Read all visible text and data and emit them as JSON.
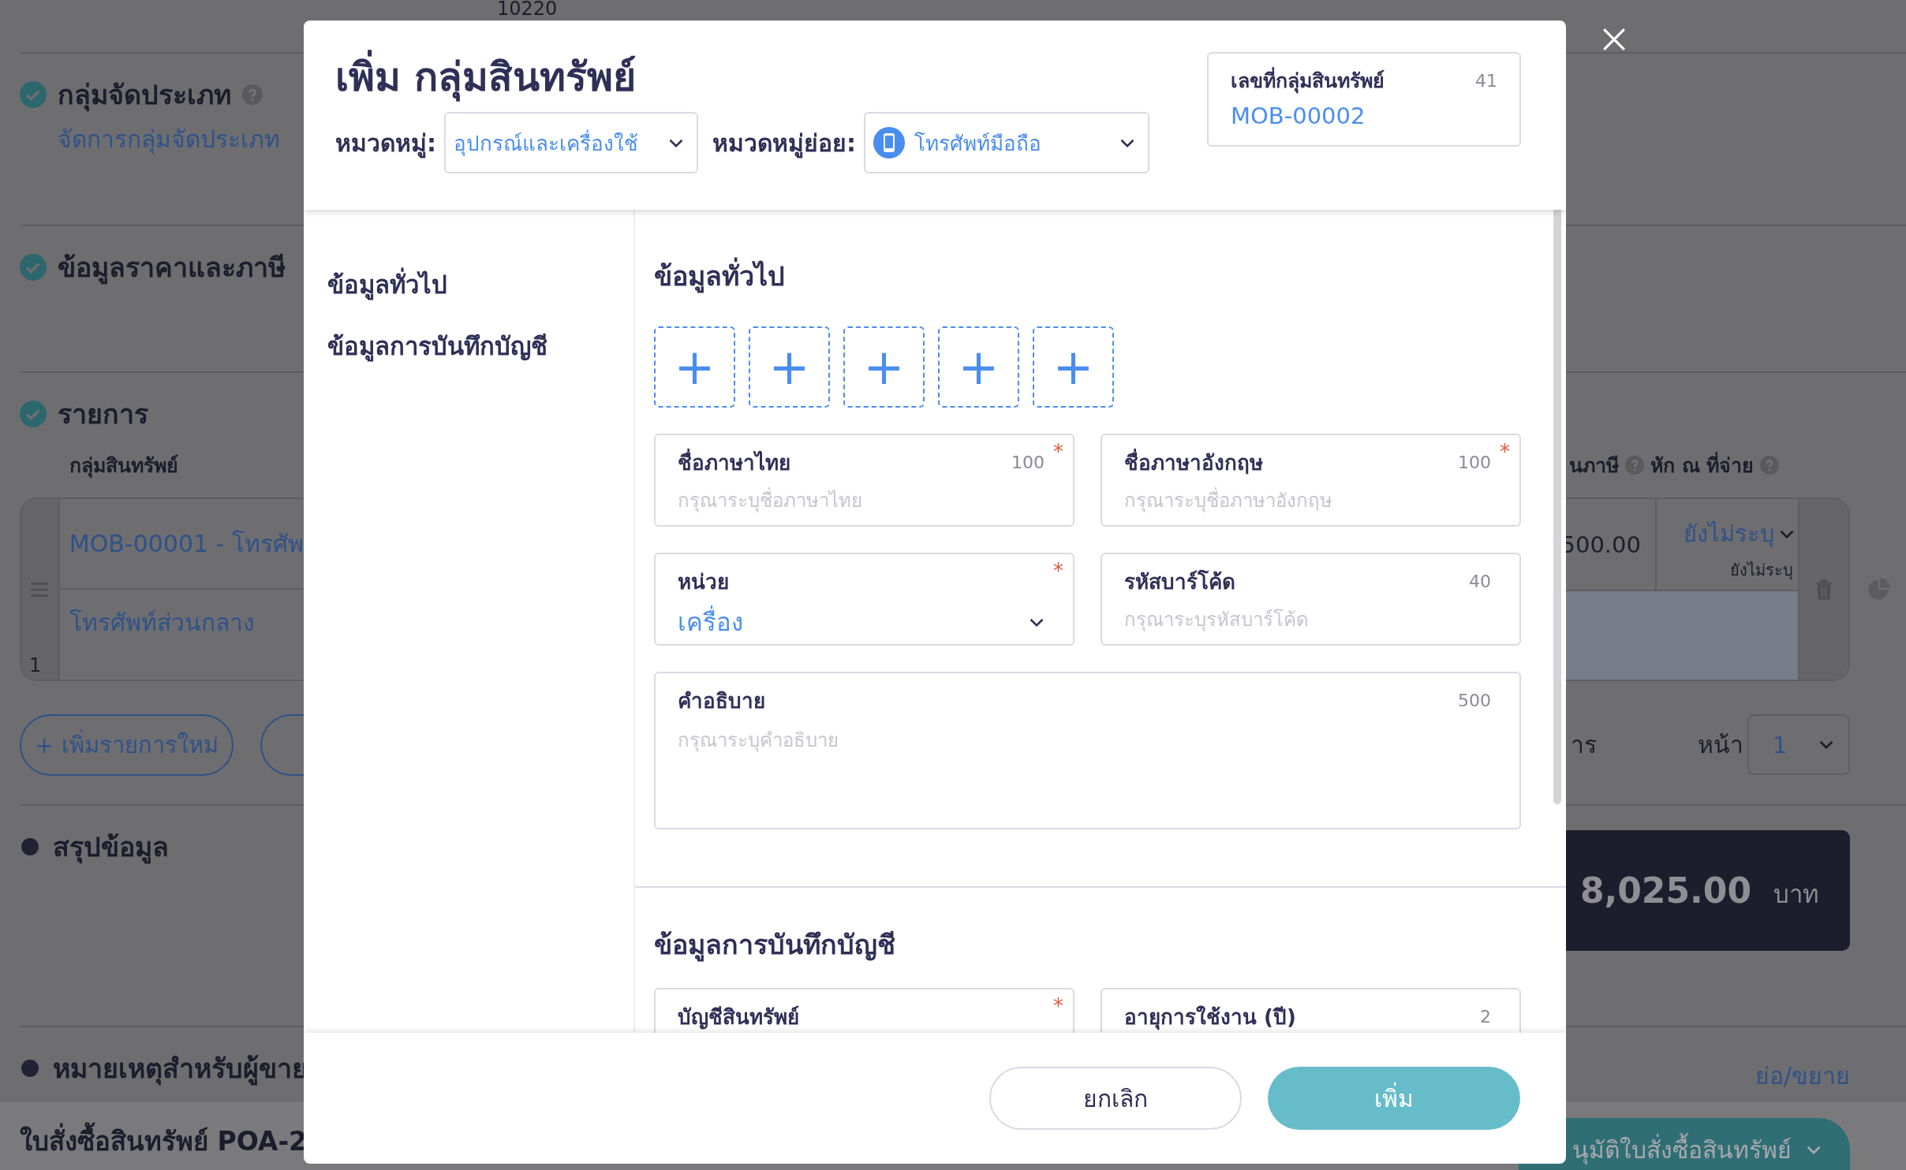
{
  "page": {
    "postal_code": "10220",
    "classification": {
      "title": "กลุ่มจัดประเภท",
      "done": true,
      "help": true,
      "link": "จัดการกลุ่มจัดประเภท"
    },
    "pricing": {
      "title": "ข้อมูลราคาและภาษี",
      "done": true
    },
    "items": {
      "title": "รายการ",
      "done": true,
      "columns": [
        {
          "label": "กลุ่มสินทรัพย์",
          "help": false
        },
        {
          "label": "นภาษี",
          "help": true
        },
        {
          "label": "หัก ณ ที่จ่าย",
          "help": true
        }
      ],
      "row": {
        "number": "1",
        "asset": "MOB-00001 - โทรศัพ",
        "description": "โทรศัพท์ส่วนกลาง",
        "amount": "500.00",
        "withholding": "ยังไม่ระบุ",
        "withholding_note": "ยังไม่ระบุ"
      },
      "add_button": "+ เพิ่มรายการใหม่",
      "pager_text": "าร",
      "page_label": "หน้า",
      "page": "1"
    },
    "summary": {
      "title": "สรุปข้อมูล",
      "done": false,
      "total": "8,025.00",
      "currency": "บาท"
    },
    "notes": {
      "title": "หมายเหตุสำหรับผู้ขาย",
      "done": false,
      "toggle": "ย่อ/ขยาย"
    },
    "bottom_bar": {
      "document": "ใบสั่งซื้อสินทรัพย์ POA-2",
      "approve": "นุมัติใบสั่งซื้อสินทรัพย์"
    }
  },
  "dialog": {
    "title": "เพิ่ม กลุ่มสินทรัพย์",
    "category_label": "หมวดหมู่:",
    "category": "อุปกรณ์และเครื่องใช้",
    "subcategory_label": "หมวดหมู่ย่อย:",
    "subcategory": "โทรศัพท์มือถือ",
    "code": {
      "label": "เลขที่กลุ่มสินทรัพย์",
      "limit": "41",
      "value": "MOB-00002"
    },
    "nav": [
      {
        "label": "ข้อมูลทั่วไป",
        "selected": false
      },
      {
        "label": "ข้อมูลการบันทึกบัญชี",
        "selected": false
      }
    ],
    "required_mark": "*",
    "general": {
      "heading": "ข้อมูลทั่วไป",
      "photo_slots": [
        "+",
        "+",
        "+",
        "+",
        "+"
      ],
      "fields": [
        {
          "kind": "text",
          "label": "ชื่อภาษาไทย",
          "limit": "100",
          "required": true,
          "placeholder": "กรุณาระบุชื่อภาษาไทย"
        },
        {
          "kind": "text",
          "label": "ชื่อภาษาอังกฤษ",
          "limit": "100",
          "required": true,
          "placeholder": "กรุณาระบุชื่อภาษาอังกฤษ"
        },
        {
          "kind": "select",
          "label": "หน่วย",
          "required": true,
          "value": "เครื่อง"
        },
        {
          "kind": "text",
          "label": "รหัสบาร์โค้ด",
          "limit": "40",
          "required": false,
          "placeholder": "กรุณาระบุรหัสบาร์โค้ด"
        },
        {
          "kind": "textarea",
          "label": "คำอธิบาย",
          "limit": "500",
          "required": false,
          "placeholder": "กรุณาระบุคำอธิบาย"
        }
      ]
    },
    "accounting": {
      "heading": "ข้อมูลการบันทึกบัญชี",
      "fields": [
        {
          "label": "บัญชีสินทรัพย์",
          "required": true
        },
        {
          "label": "อายุการใช้งาน (ปี)",
          "limit": "2",
          "required": false
        }
      ]
    },
    "buttons": {
      "cancel": "ยกเลิก",
      "submit": "เพิ่ม"
    }
  }
}
